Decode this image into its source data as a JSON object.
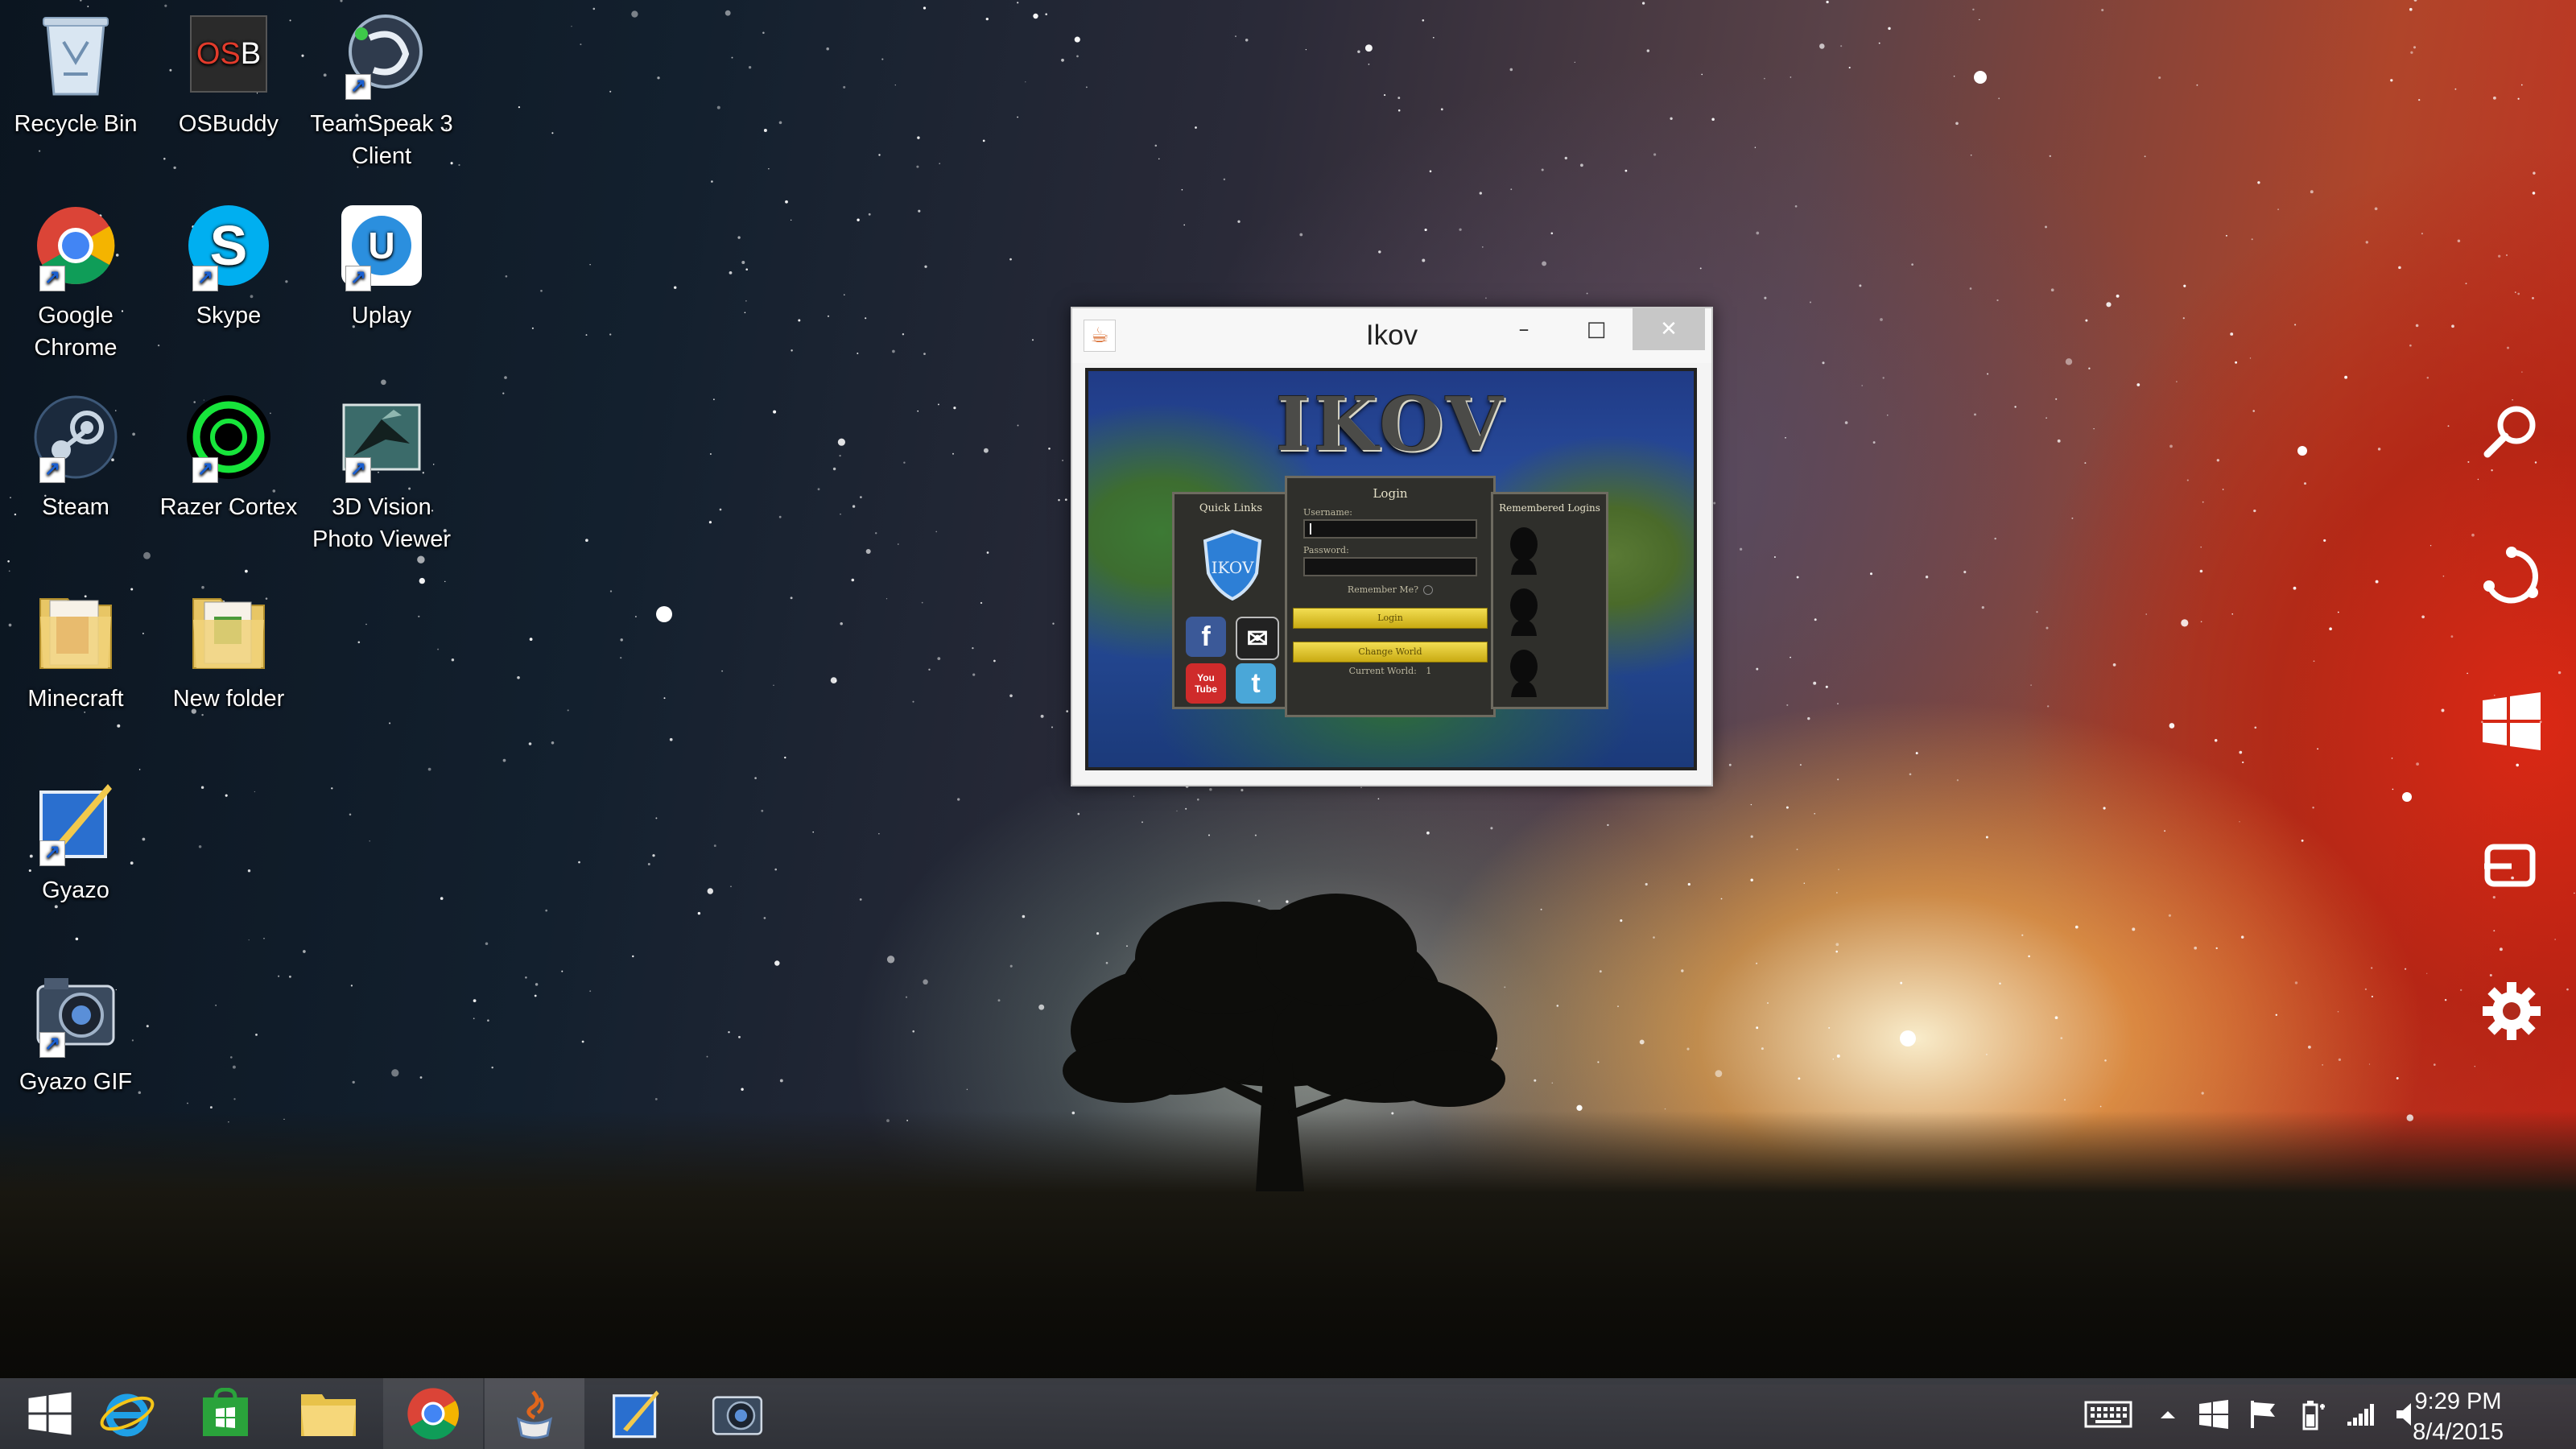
{
  "desktop_icons": [
    {
      "label": "Recycle Bin",
      "icon": "recycle-bin-icon"
    },
    {
      "label": "OSBuddy",
      "icon": "osbuddy-icon",
      "glyph_text": "OSB"
    },
    {
      "label": "TeamSpeak 3\nClient",
      "icon": "teamspeak-icon"
    },
    {
      "label": "Google\nChrome",
      "icon": "chrome-icon"
    },
    {
      "label": "Skype",
      "icon": "skype-icon",
      "glyph_text": "S"
    },
    {
      "label": "Uplay",
      "icon": "uplay-icon",
      "glyph_text": "U"
    },
    {
      "label": "Steam",
      "icon": "steam-icon"
    },
    {
      "label": "Razer Cortex",
      "icon": "razer-cortex-icon"
    },
    {
      "label": "3D Vision\nPhoto Viewer",
      "icon": "3d-vision-icon"
    },
    {
      "label": "Minecraft",
      "icon": "minecraft-folder-icon"
    },
    {
      "label": "New folder",
      "icon": "new-folder-icon"
    },
    {
      "label": "Gyazo",
      "icon": "gyazo-icon"
    },
    {
      "label": "Gyazo GIF",
      "icon": "gyazo-gif-icon"
    }
  ],
  "window": {
    "title": "Ikov",
    "minimize_glyph": "–",
    "maximize_glyph": "□",
    "close_glyph": "✕",
    "app_icon_glyph": "☕"
  },
  "game": {
    "logo_text": "IKOV",
    "shield_text": "IKOV",
    "quick_links_title": "Quick Links",
    "login_title": "Login",
    "username_label": "Username:",
    "password_label": "Password:",
    "remember_label": "Remember Me?",
    "login_button": "Login",
    "change_world_button": "Change World",
    "current_world_label": "Current World:",
    "current_world_value": "1",
    "remembered_title": "Remembered Logins",
    "social": {
      "facebook": "f",
      "youtube_top": "You",
      "youtube_bottom": "Tube",
      "twitter": "t",
      "mail": "✉"
    }
  },
  "charms": [
    {
      "name": "search-charm",
      "icon": "search-icon"
    },
    {
      "name": "share-charm",
      "icon": "share-icon"
    },
    {
      "name": "start-charm",
      "icon": "windows-logo-icon"
    },
    {
      "name": "devices-charm",
      "icon": "devices-icon"
    },
    {
      "name": "settings-charm",
      "icon": "gear-icon"
    }
  ],
  "taskbar": {
    "items": [
      "start",
      "internet-explorer",
      "store",
      "file-explorer",
      "chrome",
      "java",
      "gyazo",
      "gyazo-gif"
    ],
    "active_item": "java",
    "clock_time": "9:29 PM",
    "clock_date": "8/4/2015"
  }
}
